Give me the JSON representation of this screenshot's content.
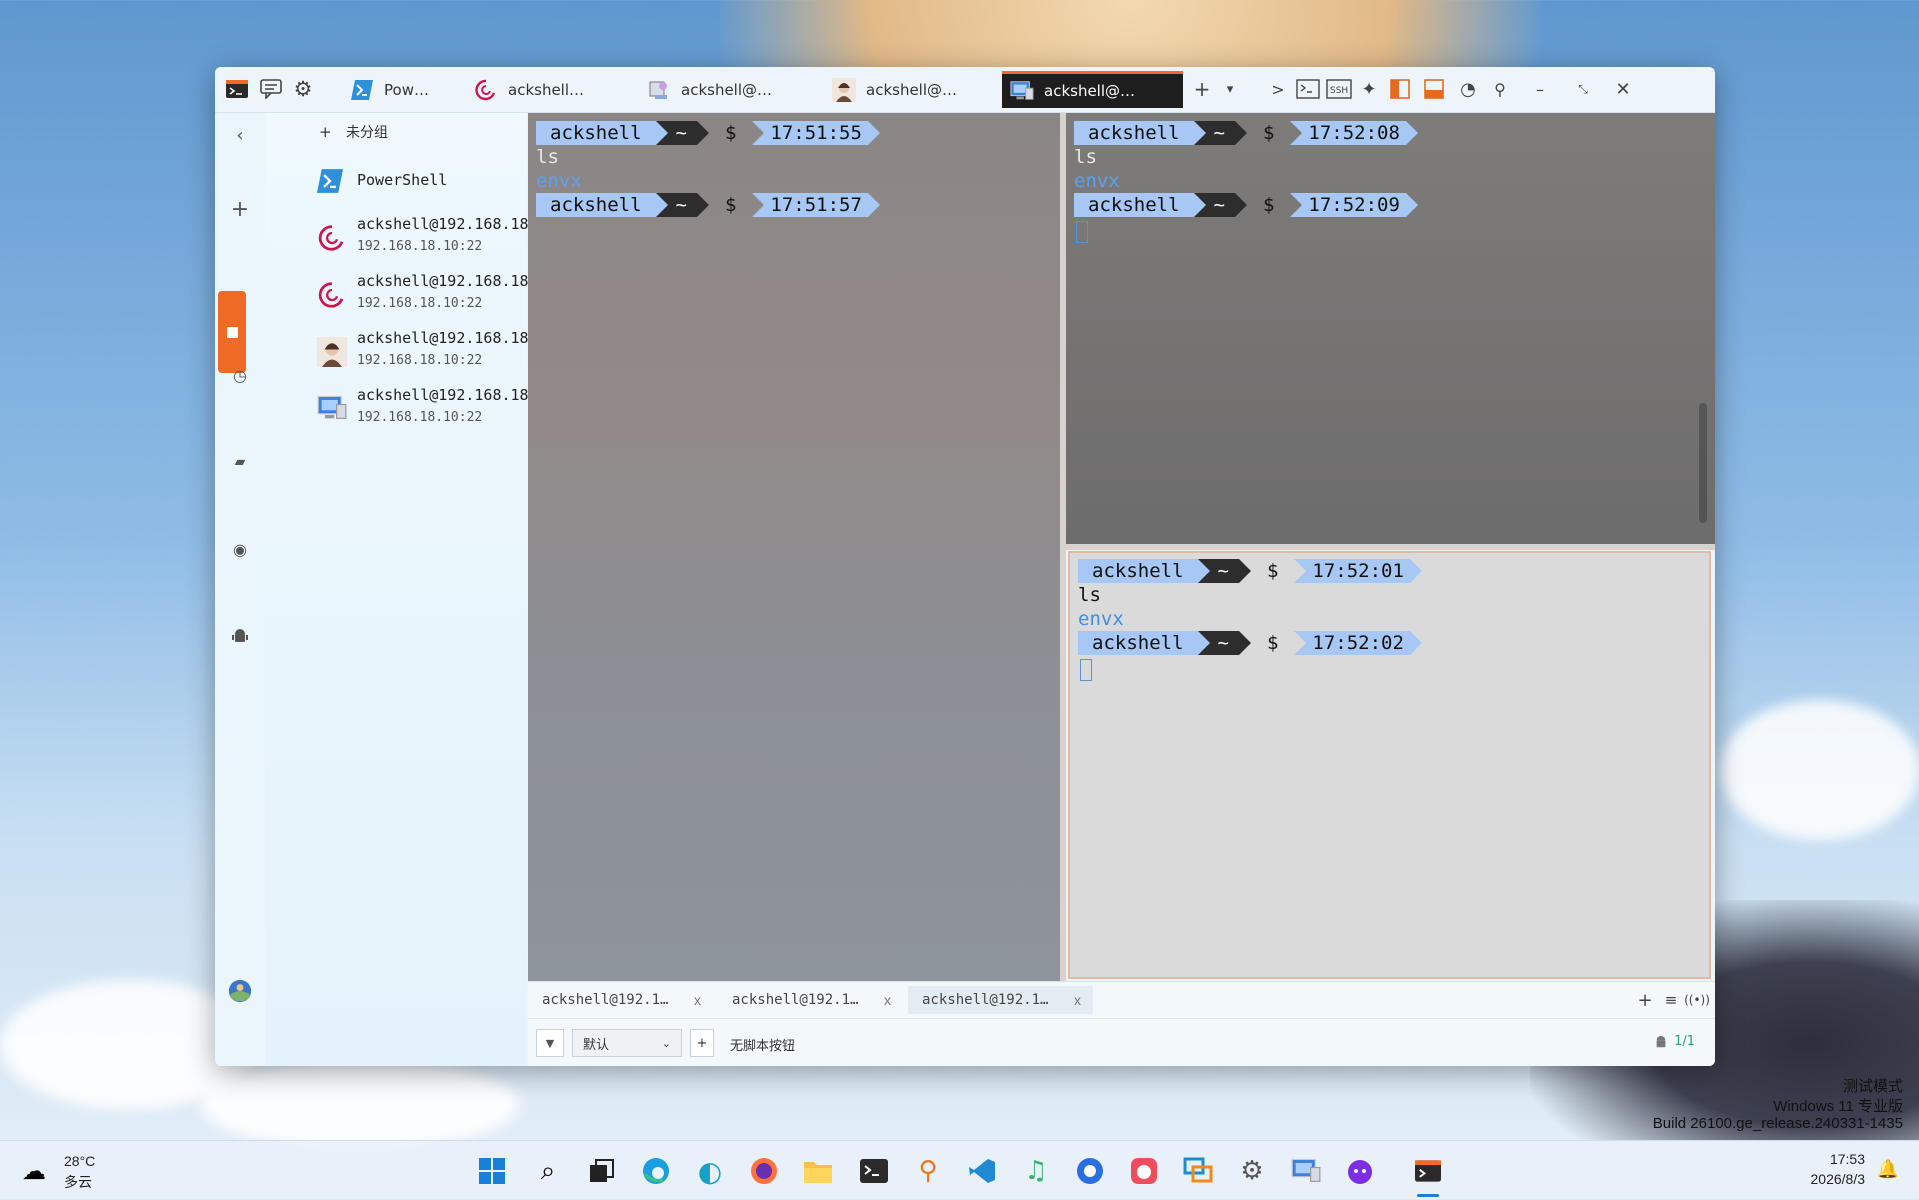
{
  "window": {
    "tabs": [
      {
        "label": "Pow…",
        "icon": "powershell-icon"
      },
      {
        "label": "ackshell…",
        "icon": "debian-icon"
      },
      {
        "label": "ackshell@…",
        "icon": "server-icon"
      },
      {
        "label": "ackshell@…",
        "icon": "avatar-icon"
      },
      {
        "label": "ackshell@…",
        "icon": "monitor-icon",
        "active": true
      }
    ],
    "toolbar": {
      "add": "+",
      "dropdown": "▾",
      "more": ">"
    }
  },
  "sidebar": {
    "group_label": "未分组",
    "hosts": [
      {
        "name": "PowerShell",
        "addr": ""
      },
      {
        "name": "ackshell@192.168.18…",
        "addr": "192.168.18.10:22"
      },
      {
        "name": "ackshell@192.168.18…",
        "addr": "192.168.18.10:22"
      },
      {
        "name": "ackshell@192.168.18…",
        "addr": "192.168.18.10:22"
      },
      {
        "name": "ackshell@192.168.18…",
        "addr": "192.168.18.10:22"
      }
    ]
  },
  "terminals": {
    "left": {
      "p1": {
        "user": "ackshell",
        "dir": "~",
        "sym": "$",
        "time": "17:51:55"
      },
      "cmd": "ls",
      "out": "envx",
      "p2": {
        "user": "ackshell",
        "dir": "~",
        "sym": "$",
        "time": "17:51:57"
      }
    },
    "rtop": {
      "p1": {
        "user": "ackshell",
        "dir": "~",
        "sym": "$",
        "time": "17:52:08"
      },
      "cmd": "ls",
      "out": "envx",
      "p2": {
        "user": "ackshell",
        "dir": "~",
        "sym": "$",
        "time": "17:52:09"
      }
    },
    "rbot": {
      "p1": {
        "user": "ackshell",
        "dir": "~",
        "sym": "$",
        "time": "17:52:01"
      },
      "cmd": "ls",
      "out": "envx",
      "p2": {
        "user": "ackshell",
        "dir": "~",
        "sym": "$",
        "time": "17:52:02"
      }
    }
  },
  "bottom_tabs": [
    {
      "label": "ackshell@192.1…",
      "close": "x"
    },
    {
      "label": "ackshell@192.1…",
      "close": "x"
    },
    {
      "label": "ackshell@192.1…",
      "close": "x",
      "active": true
    }
  ],
  "scriptbar": {
    "profile": "默认",
    "add": "+",
    "no_script": "无脚本按钮",
    "page": "1/1"
  },
  "taskbar": {
    "weather_temp": "28°C",
    "weather_desc": "多云",
    "time": "17:53",
    "date": "2026/8/3"
  },
  "watermark": {
    "line1": "测试模式",
    "line2": "Windows 11 专业版",
    "line3": "Build 26100.ge_release.240331-1435"
  },
  "colors": {
    "accent": "#ee6a25",
    "prompt_blue": "#a7c8f4",
    "output_blue": "#5aa2f0"
  }
}
